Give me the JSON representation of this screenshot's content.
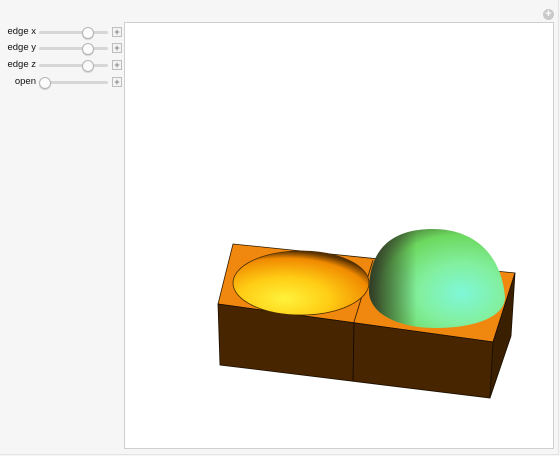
{
  "controls": [
    {
      "label": "edge x",
      "value": 0.7
    },
    {
      "label": "edge y",
      "value": 0.7
    },
    {
      "label": "edge z",
      "value": 0.7
    },
    {
      "label": "open",
      "value": 0.0
    }
  ],
  "colors": {
    "box_top": "#f08a10",
    "box_front": "#4a2700",
    "bowl_yellow": "#ffd21a",
    "bowl_orange": "#ff8a00",
    "dome_green": "#7af07a",
    "dome_cyan": "#6ff0d0",
    "dome_dark": "#3e4a2c"
  },
  "icons": {
    "corner": "plus-circle-icon",
    "slider_plus": "plus-square-icon"
  }
}
